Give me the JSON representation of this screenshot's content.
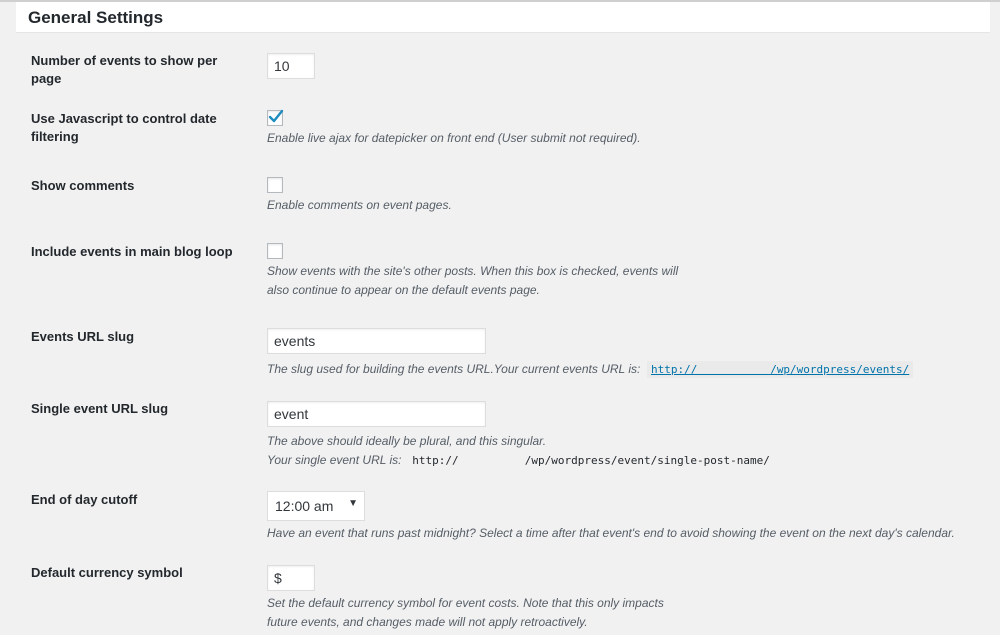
{
  "section": {
    "title": "General Settings"
  },
  "settings": {
    "events_per_page": {
      "label_line1": "Number of events to show per",
      "label_line2": "page",
      "value": "10"
    },
    "js_filtering": {
      "label_line1": "Use Javascript to control date",
      "label_line2": "filtering",
      "checked": true,
      "description": "Enable live ajax for datepicker on front end (User submit not required)."
    },
    "show_comments": {
      "label": "Show comments",
      "checked": false,
      "description": "Enable comments on event pages."
    },
    "main_loop": {
      "label": "Include events in main blog loop",
      "checked": false,
      "description_line1": "Show events with the site's other posts. When this box is checked, events will",
      "description_line2": "also continue to appear on the default events page."
    },
    "events_slug": {
      "label": "Events URL slug",
      "value": "events",
      "description": "The slug used for building the events URL.Your current events URL is:",
      "url": "http://           /wp/wordpress/events/"
    },
    "single_slug": {
      "label": "Single event URL slug",
      "value": "event",
      "description_line1": "The above should ideally be plural, and this singular.",
      "description_line2": "Your single event URL is:",
      "url": "http://          /wp/wordpress/event/single-post-name/"
    },
    "day_cutoff": {
      "label": "End of day cutoff",
      "value": "12:00 am",
      "description": "Have an event that runs past midnight? Select a time after that event's end to avoid showing the event on the next day's calendar."
    },
    "currency": {
      "label": "Default currency symbol",
      "value": "$",
      "description_line1": "Set the default currency symbol for event costs. Note that this only impacts",
      "description_line2": "future events, and changes made will not apply retroactively."
    }
  }
}
